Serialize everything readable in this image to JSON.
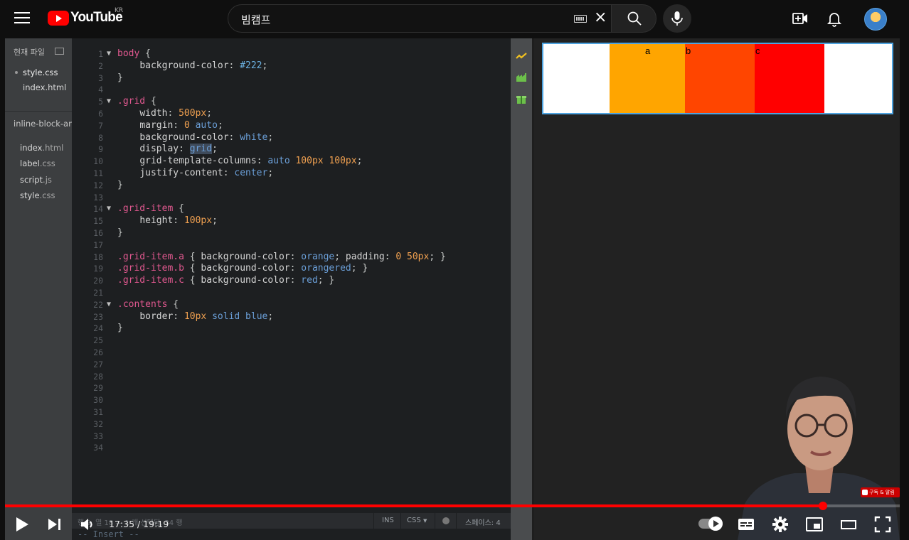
{
  "header": {
    "logo_text": "YouTube",
    "region": "KR",
    "search_value": "빔캠프"
  },
  "editor": {
    "sidebar": {
      "working_files_title": "현재 파일",
      "working_files": [
        "style.css",
        "index.html"
      ],
      "project_name": "inline-block-an",
      "project_files": [
        {
          "name": "index",
          "ext": ".html"
        },
        {
          "name": "label",
          "ext": ".css"
        },
        {
          "name": "script",
          "ext": ".js"
        },
        {
          "name": "style",
          "ext": ".css"
        }
      ]
    },
    "line_numbers": [
      "1",
      "2",
      "3",
      "4",
      "5",
      "6",
      "7",
      "8",
      "9",
      "10",
      "11",
      "12",
      "13",
      "14",
      "15",
      "16",
      "17",
      "18",
      "19",
      "20",
      "21",
      "22",
      "23",
      "24",
      "25",
      "26",
      "27",
      "28",
      "29",
      "30",
      "31",
      "32",
      "33",
      "34"
    ],
    "status": {
      "position": "행 9, 열 18 — 1 개 선택됨, 34 행",
      "mode": "INS",
      "language": "CSS",
      "indent": "스페이스: 4"
    },
    "insert_line": "-- Insert --"
  },
  "preview": {
    "labels": [
      "a",
      "b",
      "c"
    ],
    "colors": {
      "grid_bg": "#ffffff",
      "a": "#ffa500",
      "b": "#ff4500",
      "c": "#ff0000",
      "border": "#4da3e0"
    }
  },
  "player": {
    "time_display": "17:35 / 19:19",
    "progress_fraction": 0.914,
    "subscribe_badge": "구독 & 알림"
  },
  "colors": {
    "accent": "#ff0000",
    "background": "#0f0f0f"
  }
}
